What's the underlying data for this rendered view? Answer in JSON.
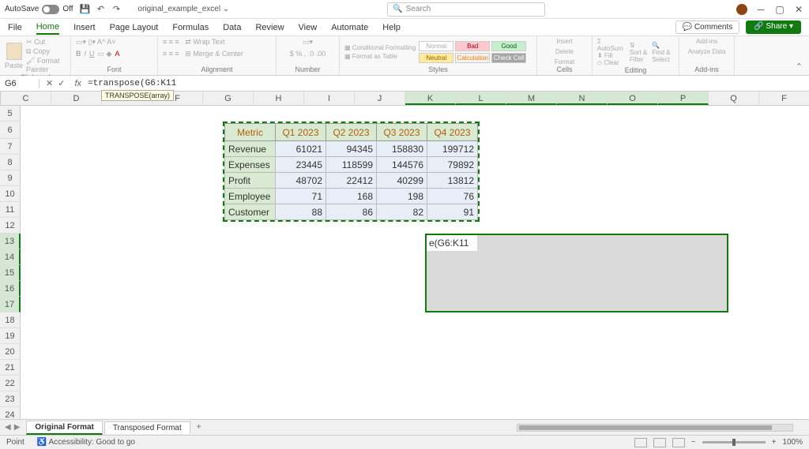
{
  "titlebar": {
    "autosave_label": "AutoSave",
    "autosave_state": "Off",
    "filename": "original_example_excel",
    "search_placeholder": "Search"
  },
  "ribbon_tabs": [
    "File",
    "Home",
    "Insert",
    "Page Layout",
    "Formulas",
    "Data",
    "Review",
    "View",
    "Automate",
    "Help"
  ],
  "ribbon_active": "Home",
  "ribbon_right": {
    "comments": "Comments",
    "share": "Share"
  },
  "ribbon_groups": {
    "clipboard": {
      "label": "Clipboard",
      "paste": "Paste",
      "cut": "Cut",
      "copy": "Copy",
      "format_painter": "Format Painter"
    },
    "font": {
      "label": "Font"
    },
    "alignment": {
      "label": "Alignment",
      "wrap": "Wrap Text",
      "merge": "Merge & Center"
    },
    "number": {
      "label": "Number"
    },
    "styles": {
      "label": "Styles",
      "cond": "Conditional Formatting",
      "table": "Format as Table",
      "normal": "Normal",
      "bad": "Bad",
      "good": "Good",
      "neutral": "Neutral",
      "calc": "Calculation",
      "check": "Check Cell"
    },
    "cells": {
      "label": "Cells",
      "insert": "Insert",
      "delete": "Delete",
      "format": "Format"
    },
    "editing": {
      "label": "Editing",
      "autosum": "AutoSum",
      "fill": "Fill",
      "clear": "Clear",
      "sort": "Sort & Filter",
      "find": "Find & Select"
    },
    "addins": {
      "label": "Add-ins",
      "addins": "Add-ins",
      "analyze": "Analyze Data"
    }
  },
  "formula_bar": {
    "namebox": "G6",
    "formula": "=transpose(G6:K11",
    "tooltip": "TRANSPOSE(array)"
  },
  "columns": [
    "C",
    "D",
    "E",
    "F",
    "G",
    "H",
    "I",
    "J",
    "K",
    "L",
    "M",
    "N",
    "O",
    "P",
    "Q",
    "F"
  ],
  "sel_cols": [
    "K",
    "L",
    "M",
    "N",
    "O",
    "P"
  ],
  "rows": [
    5,
    6,
    7,
    8,
    9,
    10,
    11,
    12,
    13,
    14,
    15,
    16,
    17,
    18,
    19,
    20,
    21,
    22,
    23,
    24
  ],
  "sel_rows": [
    13,
    14,
    15,
    16,
    17
  ],
  "table": {
    "headers": [
      "Metric",
      "Q1 2023",
      "Q2 2023",
      "Q3 2023",
      "Q4 2023"
    ],
    "rows": [
      {
        "label": "Revenue",
        "vals": [
          61021,
          94345,
          158830,
          199712
        ]
      },
      {
        "label": "Expenses",
        "vals": [
          23445,
          118599,
          144576,
          79892
        ]
      },
      {
        "label": "Profit",
        "vals": [
          48702,
          22412,
          40299,
          13812
        ]
      },
      {
        "label": "Employee",
        "vals": [
          71,
          168,
          198,
          76
        ]
      },
      {
        "label": "Customer",
        "vals": [
          88,
          86,
          82,
          91
        ]
      }
    ]
  },
  "active_cell_text": "e(G6:K11",
  "sheets": {
    "tabs": [
      "Original Format",
      "Transposed Format"
    ],
    "active": "Original Format"
  },
  "status": {
    "mode": "Point",
    "accessibility": "Accessibility: Good to go",
    "zoom": "100%"
  }
}
